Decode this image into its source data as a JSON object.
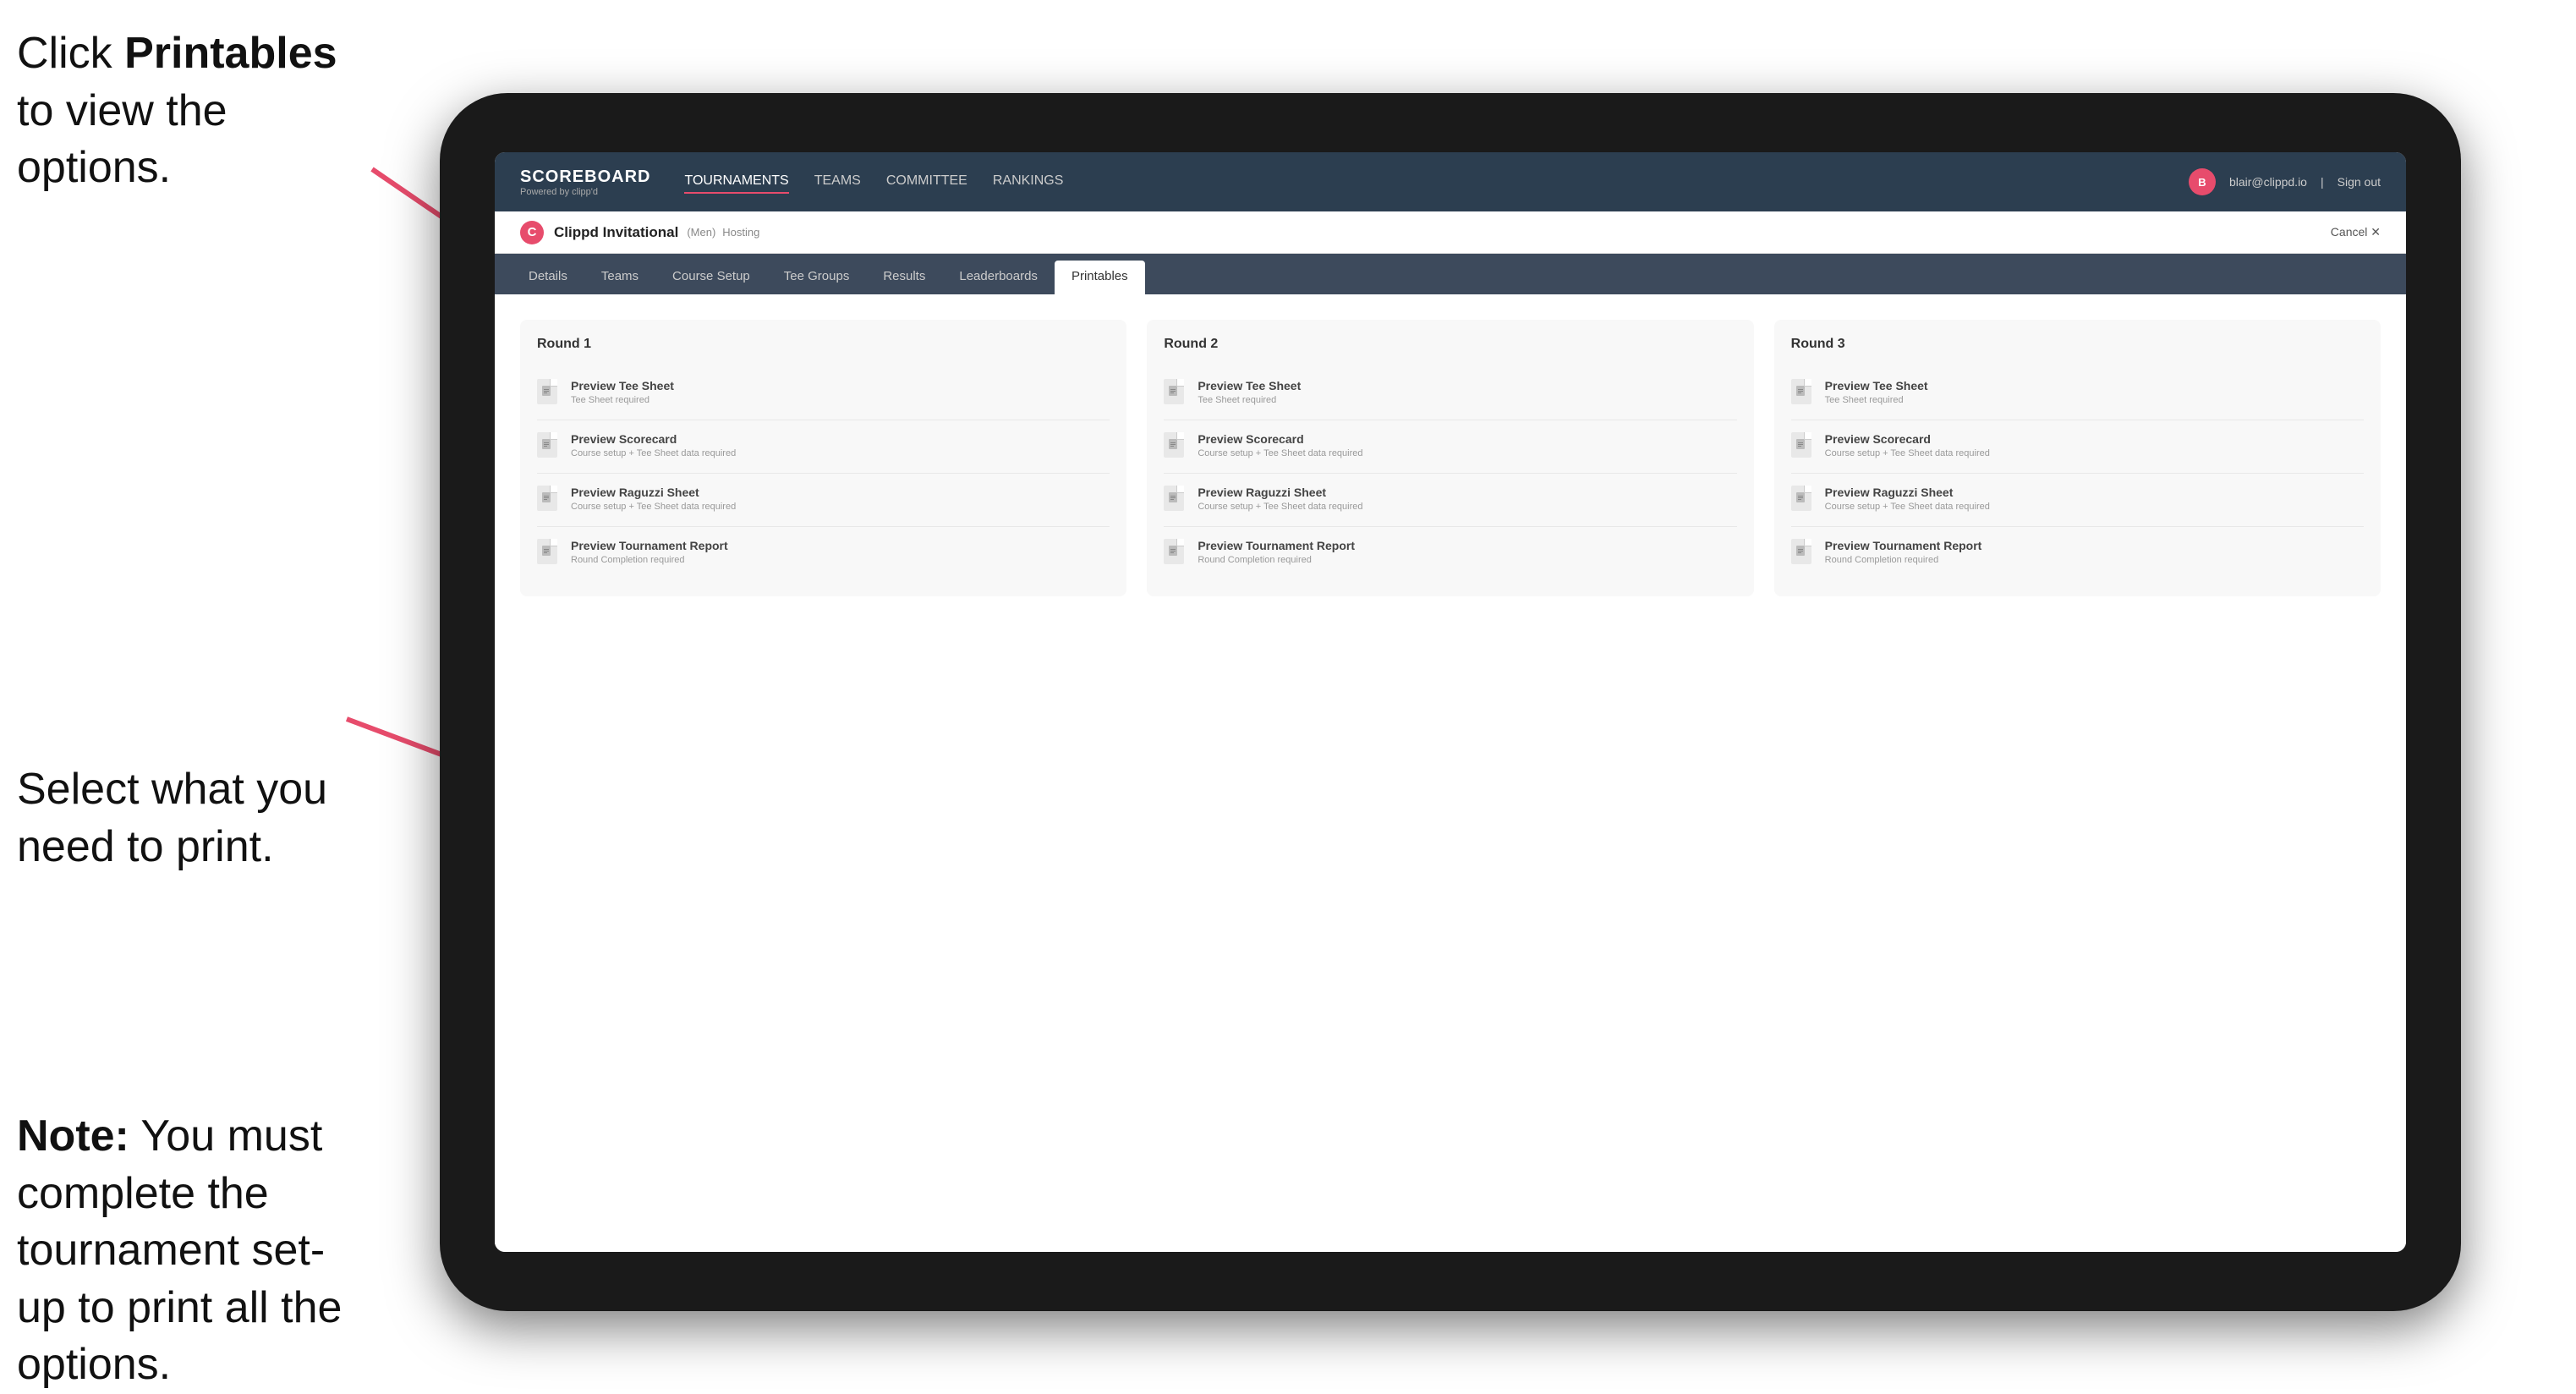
{
  "instructions": {
    "top": {
      "prefix": "Click ",
      "highlight": "Printables",
      "suffix": " to view the options."
    },
    "middle": "Select what you need to print.",
    "bottom": {
      "prefix": "Note:",
      "suffix": " You must complete the tournament set-up to print all the options."
    }
  },
  "nav": {
    "brand": "SCOREBOARD",
    "brand_sub": "Powered by clipp'd",
    "links": [
      "TOURNAMENTS",
      "TEAMS",
      "COMMITTEE",
      "RANKINGS"
    ],
    "active_link": "TOURNAMENTS",
    "user_email": "blair@clippd.io",
    "sign_out": "Sign out"
  },
  "sub_header": {
    "tournament_icon": "C",
    "tournament_name": "Clippd Invitational",
    "tournament_meta": "(Men)",
    "hosting_label": "Hosting",
    "cancel_label": "Cancel ✕"
  },
  "tabs": [
    {
      "label": "Details"
    },
    {
      "label": "Teams"
    },
    {
      "label": "Course Setup"
    },
    {
      "label": "Tee Groups"
    },
    {
      "label": "Results"
    },
    {
      "label": "Leaderboards"
    },
    {
      "label": "Printables",
      "active": true
    }
  ],
  "rounds": [
    {
      "title": "Round 1",
      "items": [
        {
          "label": "Preview Tee Sheet",
          "desc": "Tee Sheet required"
        },
        {
          "label": "Preview Scorecard",
          "desc": "Course setup + Tee Sheet data required"
        },
        {
          "label": "Preview Raguzzi Sheet",
          "desc": "Course setup + Tee Sheet data required"
        },
        {
          "label": "Preview Tournament Report",
          "desc": "Round Completion required"
        }
      ]
    },
    {
      "title": "Round 2",
      "items": [
        {
          "label": "Preview Tee Sheet",
          "desc": "Tee Sheet required"
        },
        {
          "label": "Preview Scorecard",
          "desc": "Course setup + Tee Sheet data required"
        },
        {
          "label": "Preview Raguzzi Sheet",
          "desc": "Course setup + Tee Sheet data required"
        },
        {
          "label": "Preview Tournament Report",
          "desc": "Round Completion required"
        }
      ]
    },
    {
      "title": "Round 3",
      "items": [
        {
          "label": "Preview Tee Sheet",
          "desc": "Tee Sheet required"
        },
        {
          "label": "Preview Scorecard",
          "desc": "Course setup + Tee Sheet data required"
        },
        {
          "label": "Preview Raguzzi Sheet",
          "desc": "Course setup + Tee Sheet data required"
        },
        {
          "label": "Preview Tournament Report",
          "desc": "Round Completion required"
        }
      ]
    }
  ]
}
